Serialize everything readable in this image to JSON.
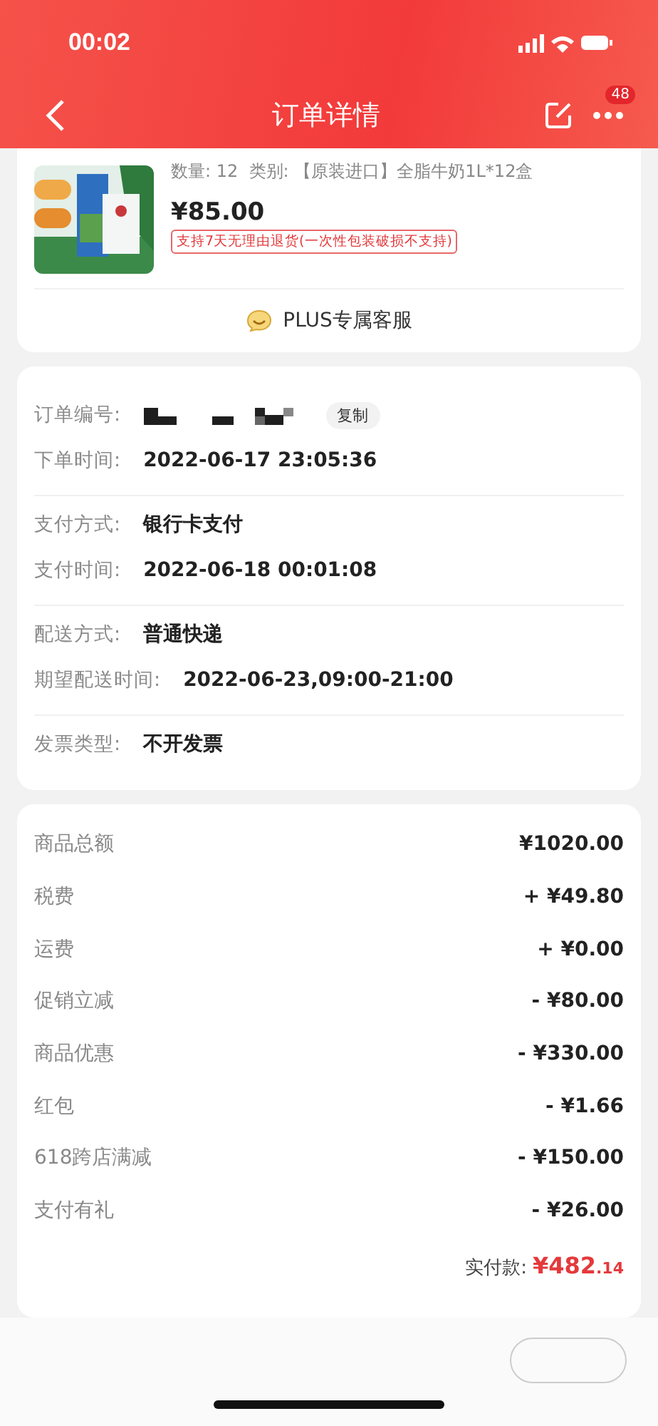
{
  "status_bar": {
    "time": "00:02"
  },
  "header": {
    "title": "订单详情",
    "badge": "48"
  },
  "product": {
    "quantity": "数量: 12",
    "variant": "类别: 【原装进口】全脂牛奶1L*12盒",
    "price": "¥85.00",
    "return_tag": "支持7天无理由退货(一次性包装破损不支持)",
    "service": "PLUS专属客服"
  },
  "order_info": {
    "number_label": "订单编号:",
    "copy_button": "复制",
    "groups": [
      [
        {
          "label": "下单时间:",
          "value": "2022-06-17 23:05:36"
        }
      ],
      [
        {
          "label": "支付方式:",
          "value": "银行卡支付"
        },
        {
          "label": "支付时间:",
          "value": "2022-06-18 00:01:08"
        }
      ],
      [
        {
          "label": "配送方式:",
          "value": "普通快递"
        },
        {
          "label": "期望配送时间:",
          "value": "2022-06-23,09:00-21:00"
        }
      ],
      [
        {
          "label": "发票类型:",
          "value": "不开发票"
        }
      ]
    ]
  },
  "amounts": [
    {
      "label": "商品总额",
      "value": "¥1020.00"
    },
    {
      "label": "税费",
      "value": "+ ¥49.80"
    },
    {
      "label": "运费",
      "value": "+ ¥0.00"
    },
    {
      "label": "促销立减",
      "value": "- ¥80.00"
    },
    {
      "label": "商品优惠",
      "value": "- ¥330.00"
    },
    {
      "label": "红包",
      "value": "- ¥1.66"
    },
    {
      "label": "618跨店满减",
      "value": "- ¥150.00"
    },
    {
      "label": "支付有礼",
      "value": "- ¥26.00"
    }
  ],
  "paid": {
    "label": "实付款:",
    "integer": "¥482",
    "decimal": ".14"
  }
}
